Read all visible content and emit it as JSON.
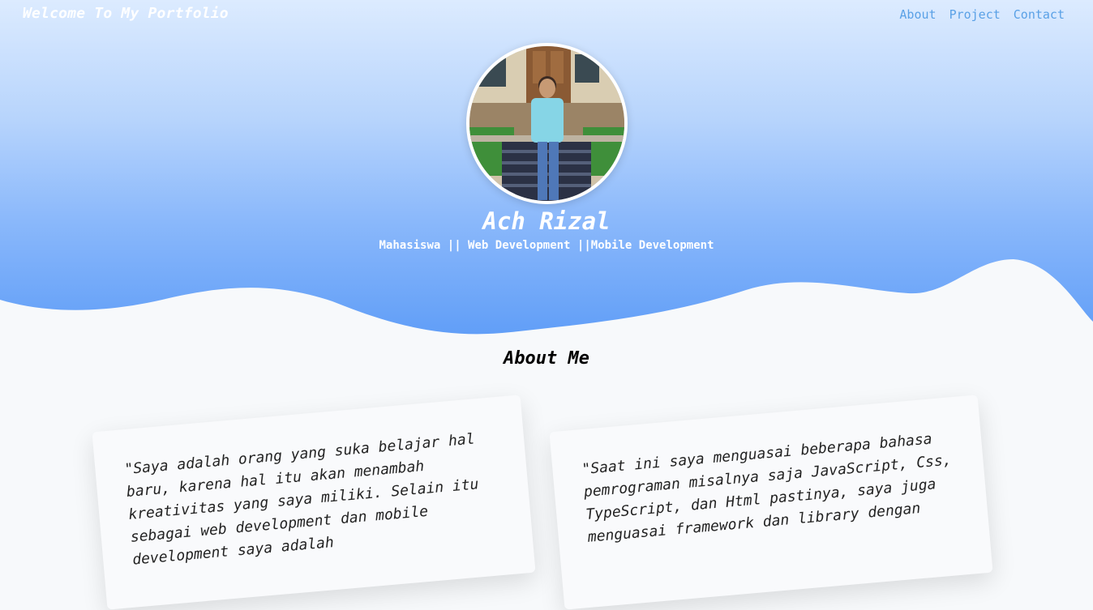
{
  "header": {
    "brand": "Welcome To My Portfolio",
    "nav": [
      {
        "label": "About"
      },
      {
        "label": "Project"
      },
      {
        "label": "Contact"
      }
    ]
  },
  "hero": {
    "name": "Ach Rizal",
    "subtitle": "Mahasiswa || Web Development ||Mobile Development"
  },
  "about": {
    "title": "About Me",
    "cards": [
      {
        "text": "\"Saya adalah orang yang suka belajar hal baru, karena hal itu akan menambah kreativitas yang saya miliki. Selain itu sebagai web development dan mobile development saya adalah"
      },
      {
        "text": "\"Saat ini saya menguasai beberapa bahasa pemrograman misalnya saja JavaScript, Css, TypeScript, dan Html pastinya, saya juga menguasai framework dan library dengan"
      }
    ]
  },
  "colors": {
    "accent": "#5aa1e6",
    "hero_bottom": "#5f9df7",
    "background": "#f7f9fb"
  }
}
